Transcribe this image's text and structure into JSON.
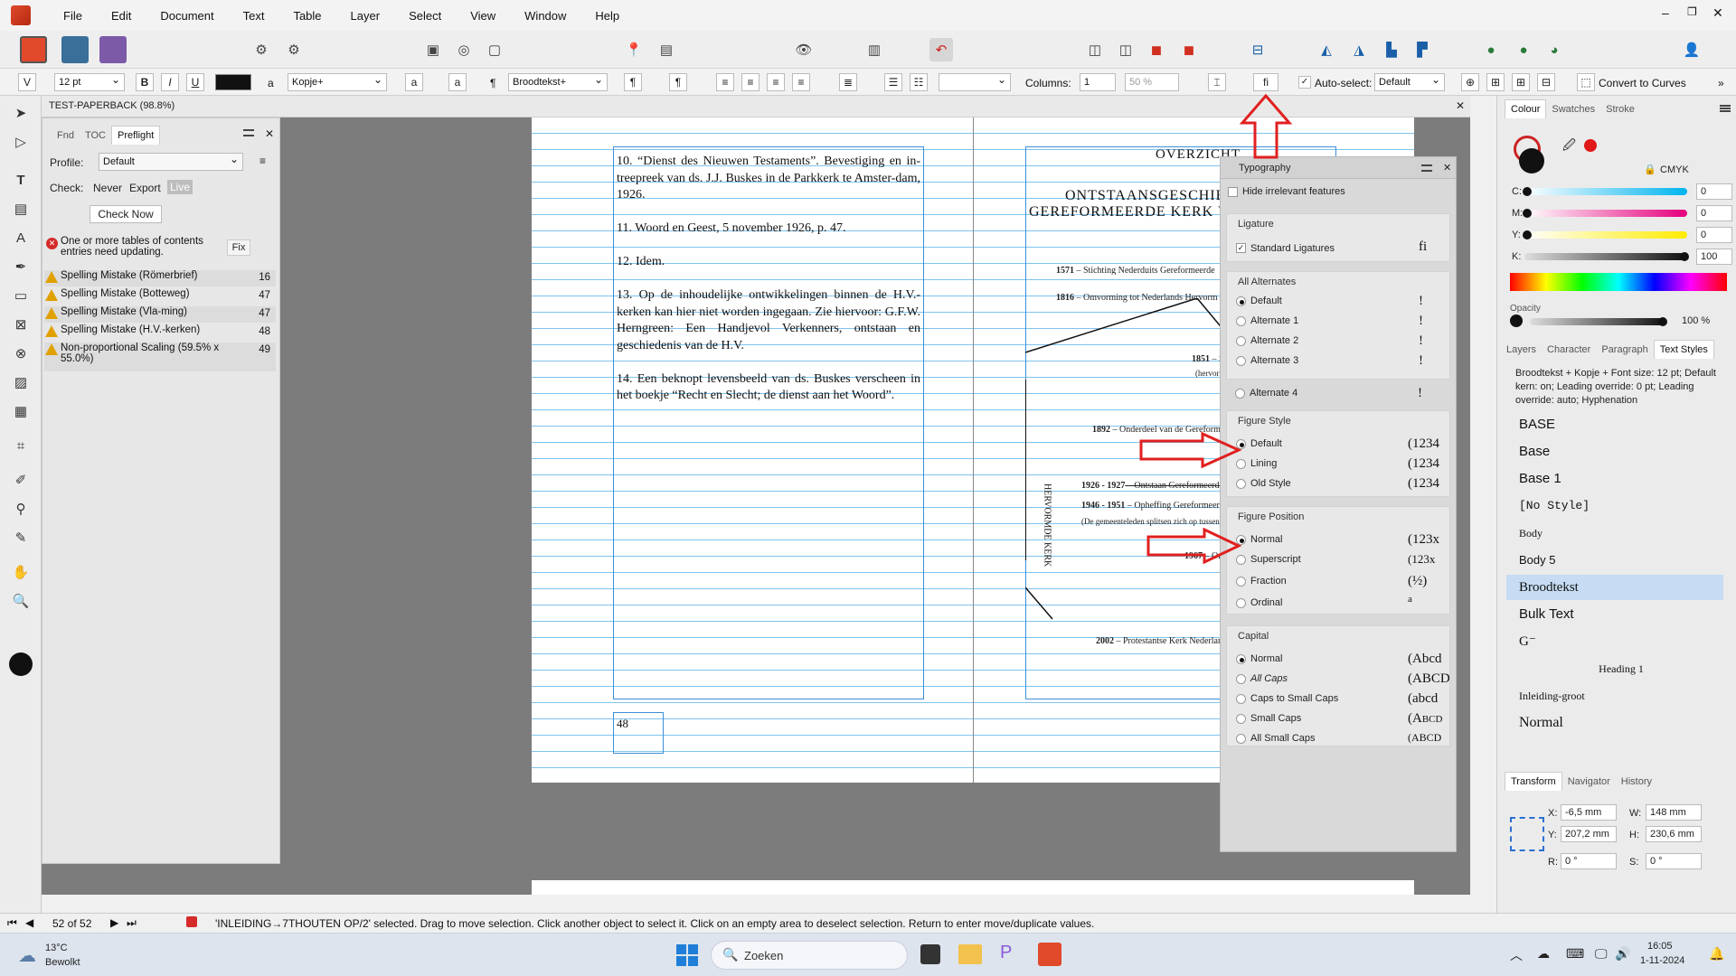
{
  "menu": [
    "File",
    "Edit",
    "Document",
    "Text",
    "Table",
    "Layer",
    "Select",
    "View",
    "Window",
    "Help"
  ],
  "toolbar2": {
    "font_size": "12 pt",
    "char_style": "Kopje+",
    "para_style": "Broodtekst+",
    "columns_label": "Columns:",
    "columns_value": "1",
    "percent": "50 %",
    "ligature_btn": "fi",
    "autoselect_label": "Auto-select:",
    "autoselect_value": "Default",
    "convert": "Convert to Curves"
  },
  "document": {
    "title": "TEST-PAPERBACK (98.8%)"
  },
  "left_page": {
    "notes": [
      "10. “Dienst des Nieuwen Testaments”. Bevestiging en in-treepreek van ds. J.J. Buskes in de Parkkerk te Amster-dam, 1926.",
      "11. Woord en Geest, 5 november 1926, p. 47.",
      "12. Idem.",
      "13. Op de inhoudelijke ontwikkelingen binnen de H.V.-kerken kan hier niet worden ingegaan. Zie hiervoor: G.F.W. Herngreen: Een Handjevol Verkenners, ontstaan en geschiedenis van de H.V.",
      "14. Een beknopt levensbeeld van ds. Buskes verscheen in het boekje “Recht en Slecht; de dienst aan het Woord”."
    ],
    "page_number": "48"
  },
  "right_page": {
    "overzicht": "OVERZICHT",
    "heading1": "ONTSTAANSGESCHIEDE",
    "heading2": "GEREFORMEERDE KERK VA",
    "vertical": "HERVORMDE KERK",
    "entries": [
      {
        "year": "1571",
        "text": " – Stichting Nederduits Gereformeerde"
      },
      {
        "year": "1816",
        "text": " – Omvorming tot Nederlands Hervorm"
      },
      {
        "year": "1851",
        "text": " – Stichting"
      },
      {
        "year": "",
        "text": "(hervormden blijv"
      },
      {
        "year": "1892",
        "text": " – Onderdeel van de Gereformeerd"
      },
      {
        "year": "1926 - 1927",
        "text": " – Ontstaan Gereformeerde K"
      },
      {
        "year": "1946 - 1951",
        "text": " – Opheffing Gereformeerde K"
      },
      {
        "year": "",
        "text": "(De gemeenteleden splitsen zich op tussen de He"
      },
      {
        "year": "1967",
        "text": " – Ontstaan G"
      },
      {
        "year": "2002",
        "text": " – Protestantse Kerk Nederland (V"
      }
    ]
  },
  "preflight": {
    "tabs": [
      "Fnd",
      "TOC",
      "Preflight"
    ],
    "profile_label": "Profile:",
    "profile_value": "Default",
    "check_label": "Check:",
    "check_options": [
      "Never",
      "Export",
      "Live"
    ],
    "check_now": "Check Now",
    "fix": "Fix",
    "issues": [
      {
        "text": "One or more tables of contents entries need updating.",
        "count": "",
        "type": "error"
      },
      {
        "text": "Spelling Mistake (Römerbrief)",
        "count": "16",
        "type": "warn"
      },
      {
        "text": "Spelling Mistake (Botteweg)",
        "count": "47",
        "type": "warn"
      },
      {
        "text": "Spelling Mistake (Vla-ming)",
        "count": "47",
        "type": "warn"
      },
      {
        "text": "Spelling Mistake (H.V.-kerken)",
        "count": "48",
        "type": "warn"
      },
      {
        "text": "Non-proportional Scaling (59.5% x 55.0%)",
        "count": "49",
        "type": "warn"
      }
    ]
  },
  "typography": {
    "title": "Typography",
    "hide": "Hide irrelevant features",
    "ligature": {
      "header": "Ligature",
      "option": "Standard Ligatures",
      "preview": "fi"
    },
    "alternates": {
      "header": "All Alternates",
      "options": [
        "Default",
        "Alternate 1",
        "Alternate 2",
        "Alternate 3",
        "Alternate 4"
      ],
      "preview": "!"
    },
    "figure_style": {
      "header": "Figure Style",
      "options": [
        "Default",
        "Lining",
        "Old Style"
      ],
      "previews": [
        "(1234",
        "(1234",
        "(1234"
      ]
    },
    "figure_position": {
      "header": "Figure Position",
      "options": [
        "Normal",
        "Superscript",
        "Fraction",
        "Ordinal"
      ],
      "previews": [
        "(123x",
        "(123x",
        "(½)",
        "a"
      ]
    },
    "capital": {
      "header": "Capital",
      "options": [
        "Normal",
        "All Caps",
        "Caps to Small Caps",
        "Small Caps",
        "All Small Caps"
      ],
      "previews": [
        "(Abcd",
        "(ABCD",
        "(abcd",
        "(Abcd",
        "(ABCD"
      ]
    }
  },
  "colour": {
    "tabs": [
      "Colour",
      "Swatches",
      "Stroke"
    ],
    "model": "CMYK",
    "channels": [
      {
        "label": "C:",
        "value": "0"
      },
      {
        "label": "M:",
        "value": "0"
      },
      {
        "label": "Y:",
        "value": "0"
      },
      {
        "label": "K:",
        "value": "100"
      }
    ],
    "opacity_label": "Opacity",
    "opacity_value": "100 %"
  },
  "text_styles": {
    "tabs": [
      "Layers",
      "Character",
      "Paragraph",
      "Text Styles"
    ],
    "description": "Broodtekst + Kopje + Font size: 12 pt; Default kern: on; Leading override: 0 pt; Leading override: auto; Hyphenation",
    "styles": [
      "BASE",
      "Base",
      "Base 1",
      "[No Style]",
      "Body",
      "Body 5",
      "Broodtekst",
      "Bulk Text",
      "G⁻",
      "Heading 1",
      "Inleiding-groot",
      "Normal"
    ]
  },
  "transform": {
    "tabs": [
      "Transform",
      "Navigator",
      "History"
    ],
    "x": "-6,5 mm",
    "y": "207,2 mm",
    "w": "148 mm",
    "h": "230,6 mm",
    "r": "0 °",
    "s": "0 °"
  },
  "status": {
    "page": "52 of 52",
    "message": "'INLEIDING→7THOUTEN OP/2' selected. Drag to move selection. Click another object to select it. Click on an empty area to deselect selection. Return to enter move/duplicate values."
  },
  "taskbar": {
    "temp": "13°C",
    "weather": "Bewolkt",
    "search": "Zoeken",
    "time": "16:05",
    "date": "1-11-2024"
  },
  "accent": "#3c8fd8",
  "arrow_color": "#e02020"
}
